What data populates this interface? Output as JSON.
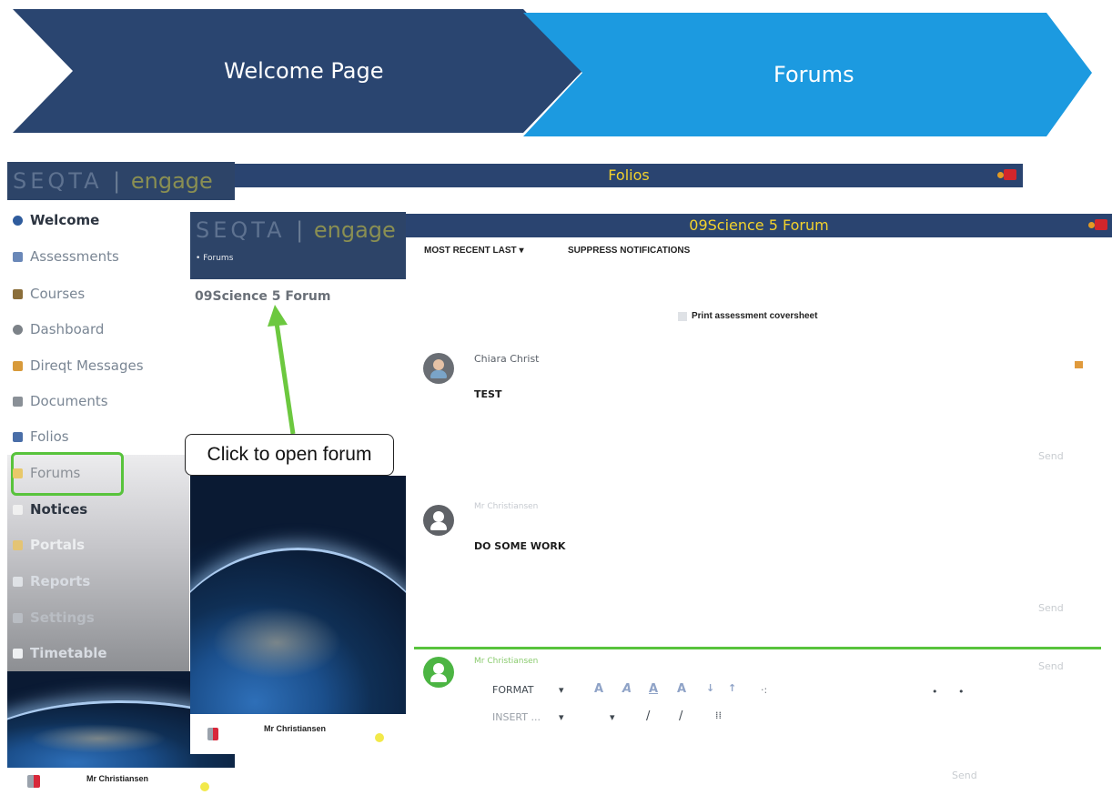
{
  "banner": {
    "steps": [
      {
        "label": "Welcome Page",
        "color": "#2a4570"
      },
      {
        "label": "Forums",
        "color": "#1c9ae0"
      }
    ]
  },
  "app": {
    "brand_seqta": "SEQTA",
    "brand_sep": "|",
    "brand_engage": "engage",
    "page_title": "Folios"
  },
  "sidebar": {
    "items": [
      {
        "label": "Welcome",
        "icon": "info-icon"
      },
      {
        "label": "Assessments",
        "icon": "assessments-icon"
      },
      {
        "label": "Courses",
        "icon": "courses-icon"
      },
      {
        "label": "Dashboard",
        "icon": "dashboard-icon"
      },
      {
        "label": "Direqt Messages",
        "icon": "messages-icon"
      },
      {
        "label": "Documents",
        "icon": "documents-icon"
      },
      {
        "label": "Folios",
        "icon": "folios-icon"
      },
      {
        "label": "Forums",
        "icon": "forums-icon"
      },
      {
        "label": "Notices",
        "icon": "notices-icon"
      },
      {
        "label": "Portals",
        "icon": "portals-icon"
      },
      {
        "label": "Reports",
        "icon": "reports-icon"
      },
      {
        "label": "Settings",
        "icon": "settings-icon"
      },
      {
        "label": "Timetable",
        "icon": "timetable-icon"
      }
    ],
    "user_name": "Mr Christiansen"
  },
  "inner": {
    "breadcrumb": "• Forums",
    "forum_link": "09Science 5 Forum",
    "forum_title": "09Science 5 Forum",
    "sort_label": "MOST RECENT LAST ▾",
    "suppress_label": "SUPPRESS NOTIFICATIONS",
    "print_label": "Print assessment coversheet",
    "user_name": "Mr Christiansen"
  },
  "posts": [
    {
      "author": "Chiara Christ",
      "text": "TEST",
      "send": "Send"
    },
    {
      "author": "Mr Christiansen",
      "text": "DO SOME WORK",
      "send": "Send"
    }
  ],
  "composer": {
    "author": "Mr Christiansen",
    "format_label": "FORMAT",
    "insert_label": "INSERT ...",
    "send_top": "Send",
    "send_bottom": "Send"
  },
  "callout": {
    "text": "Click to open forum"
  },
  "colors": {
    "highlight_green": "#58c33c",
    "title_yellow": "#f3d22c",
    "bar_blue": "#2a4470"
  }
}
